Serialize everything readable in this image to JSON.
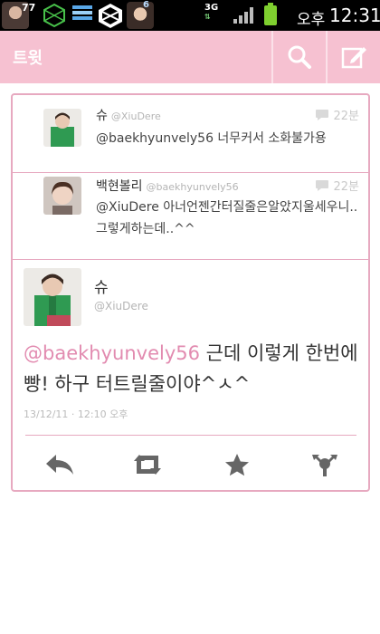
{
  "status_bar": {
    "badge_77": "77",
    "notif_num": "6",
    "network": "3G",
    "ampm": "오후",
    "time": "12:31"
  },
  "action_bar": {
    "title": "트윗"
  },
  "replies": [
    {
      "name": "슈",
      "handle": "@XiuDere",
      "time": "22분",
      "text": "@baekhyunvely56 너무커서 소화불가용"
    },
    {
      "name": "백현볼리",
      "handle": "@baekhyunvely56",
      "time": "22분",
      "text": "@XiuDere 아너언젠간터질줄은알았지울세우니..그렇게하는데..^^"
    }
  ],
  "main_tweet": {
    "name": "슈",
    "handle": "@XiuDere",
    "mention": "@baekhyunvely56",
    "text": " 근데 이렇게 한번에 빵! 하구 터트릴줄이야^ㅅ^",
    "meta": "13/12/11 · 12:10 오후"
  },
  "colors": {
    "accent": "#f6c1d1",
    "border": "#e7a9c0",
    "mention": "#e28bb0"
  }
}
